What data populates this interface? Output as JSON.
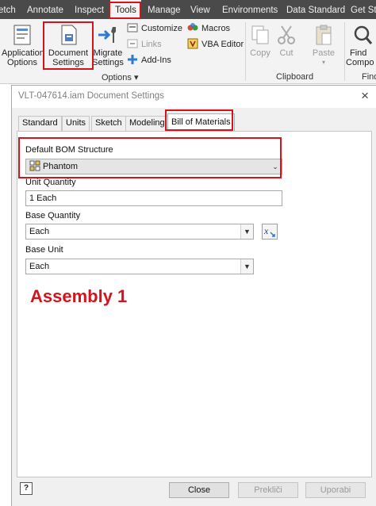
{
  "ribbon": {
    "tabs": [
      "etch",
      "Annotate",
      "Inspect",
      "Tools",
      "Manage",
      "View",
      "Environments",
      "Data Standard",
      "Get St"
    ],
    "active_tab": "Tools",
    "buttons": {
      "application_options": "Application\nOptions",
      "document_settings": "Document\nSettings",
      "migrate_settings": "Migrate\nSettings",
      "customize": "Customize",
      "links": "Links",
      "add_ins": "Add-Ins",
      "macros": "Macros",
      "vba_editor": "VBA Editor",
      "copy": "Copy",
      "cut": "Cut",
      "paste": "Paste",
      "find": "Find\nCompo"
    },
    "groups": {
      "options": "Options ▾",
      "clipboard": "Clipboard",
      "find": "Find"
    }
  },
  "dialog": {
    "title": "VLT-047614.iam Document Settings",
    "close_glyph": "×",
    "tabs": [
      "Standard",
      "Units",
      "Sketch",
      "Modeling",
      "Bill of Materials"
    ],
    "active_tab": "Bill of Materials",
    "default_bom_structure_label": "Default BOM Structure",
    "default_bom_structure_value": "Phantom",
    "unit_quantity_label": "Unit Quantity",
    "unit_quantity_value": "1 Each",
    "base_quantity_label": "Base Quantity",
    "base_quantity_value": "Each",
    "base_unit_label": "Base Unit",
    "base_unit_value": "Each",
    "annotation": "Assembly 1",
    "help_glyph": "?",
    "buttons": {
      "close": "Close",
      "cancel": "Prekliči",
      "apply": "Uporabi"
    }
  },
  "colors": {
    "highlight": "#d4141c",
    "tab_bar": "#4a4a4a",
    "ribbon_bg": "#f3f3f3",
    "dialog_bg": "#f0f0f0"
  }
}
